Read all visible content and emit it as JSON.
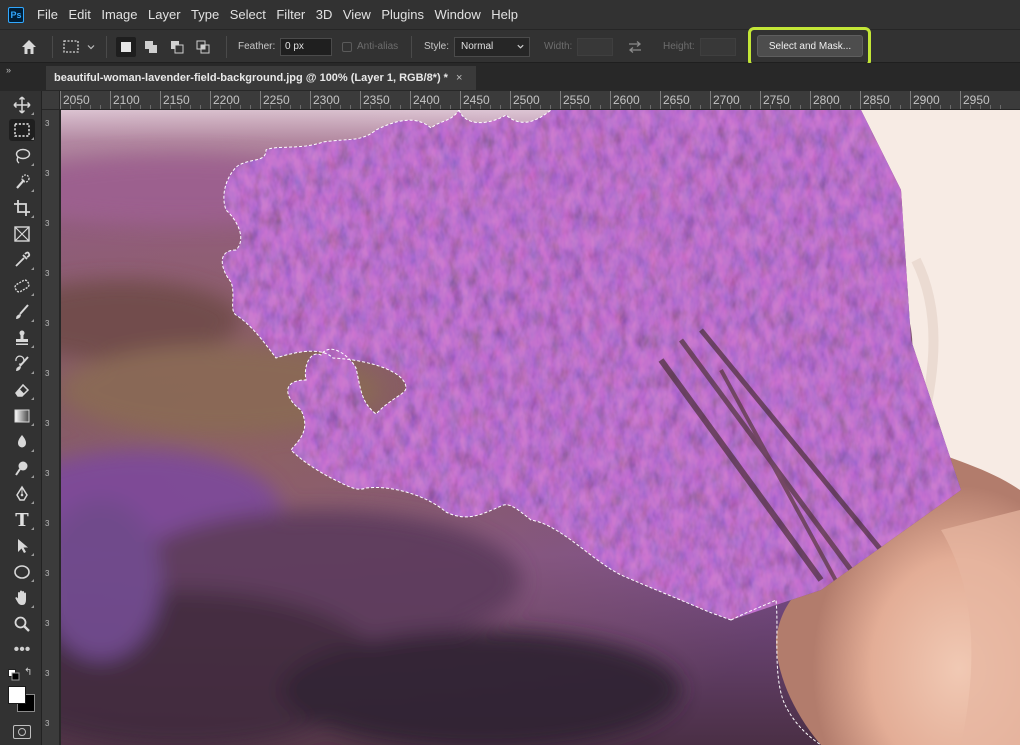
{
  "app": {
    "logo": "Ps"
  },
  "menu": {
    "items": [
      "File",
      "Edit",
      "Image",
      "Layer",
      "Type",
      "Select",
      "Filter",
      "3D",
      "View",
      "Plugins",
      "Window",
      "Help"
    ]
  },
  "options": {
    "feather_label": "Feather:",
    "feather_value": "0 px",
    "antialias_label": "Anti-alias",
    "style_label": "Style:",
    "style_value": "Normal",
    "width_label": "Width:",
    "height_label": "Height:",
    "select_and_mask_label": "Select and Mask..."
  },
  "document": {
    "tab_title": "beautiful-woman-lavender-field-background.jpg @ 100% (Layer 1, RGB/8*) *",
    "close_glyph": "×"
  },
  "rulers": {
    "horizontal": [
      "2050",
      "2100",
      "2150",
      "2200",
      "2250",
      "2300",
      "2350",
      "2400",
      "2450",
      "2500",
      "2550",
      "2600",
      "2650",
      "2700",
      "2750",
      "2800",
      "2850",
      "2900",
      "2950"
    ],
    "vertical_label": "3"
  },
  "toolbar": {
    "collapse_glyph": "»",
    "tools": [
      "move-icon",
      "rectangular-marquee-icon",
      "lasso-icon",
      "quick-selection-icon",
      "crop-icon",
      "frame-icon",
      "eyedropper-icon",
      "healing-brush-icon",
      "brush-icon",
      "clone-stamp-icon",
      "history-brush-icon",
      "eraser-icon",
      "gradient-icon",
      "blur-icon",
      "dodge-icon",
      "pen-icon",
      "type-icon",
      "path-selection-icon",
      "ellipse-icon",
      "hand-icon",
      "zoom-icon",
      "more-tools-icon"
    ],
    "type_tool_glyph": "T",
    "more_glyph": "•••",
    "swap_glyph": "↰",
    "foreground_color": "#ffffff",
    "background_color": "#000000"
  },
  "colors": {
    "highlight": "#c3e637",
    "panel": "#323232",
    "workspace": "#282828"
  }
}
